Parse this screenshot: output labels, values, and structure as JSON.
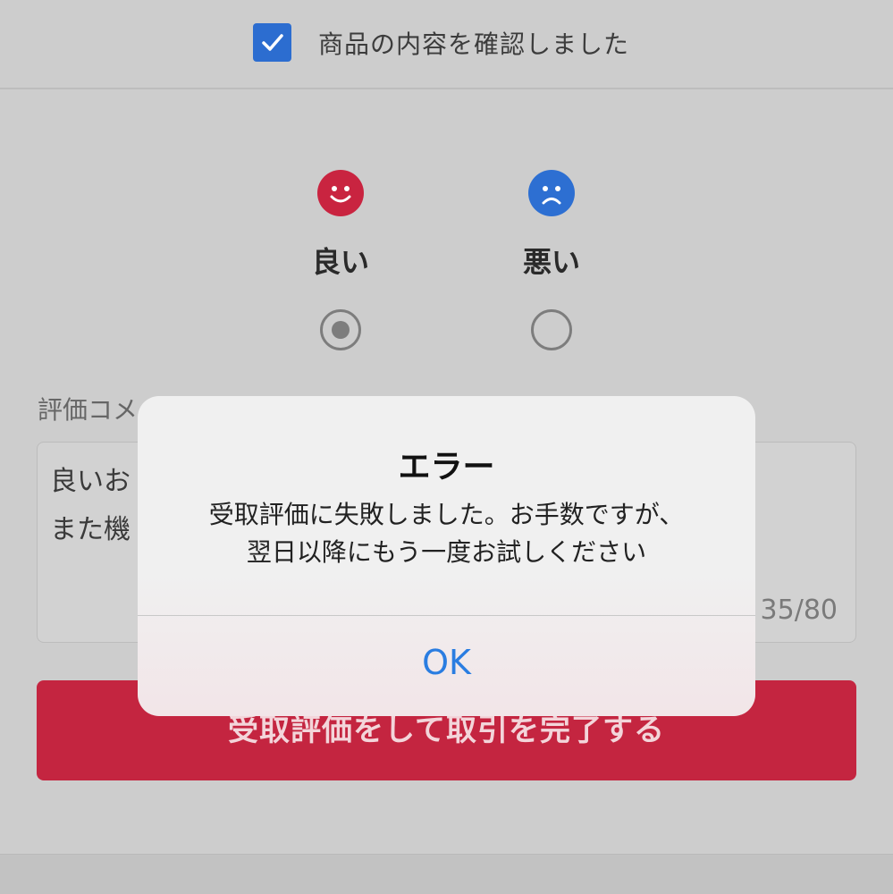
{
  "confirm": {
    "checked": true,
    "label": "商品の内容を確認しました"
  },
  "ratings": {
    "good": {
      "label": "良い",
      "selected": true,
      "icon": "smile-face-icon",
      "color": "#c92440"
    },
    "bad": {
      "label": "悪い",
      "selected": false,
      "icon": "frown-face-icon",
      "color": "#2d6fd2"
    }
  },
  "comment": {
    "label": "評価コメ",
    "line1": "良いお",
    "line2": "また機",
    "counter": "35/80"
  },
  "submit_label": "受取評価をして取引を完了する",
  "alert": {
    "title": "エラー",
    "message_line1": "受取評価に失敗しました。お手数ですが、",
    "message_line2": "翌日以降にもう一度お試しください",
    "ok_label": "OK"
  }
}
